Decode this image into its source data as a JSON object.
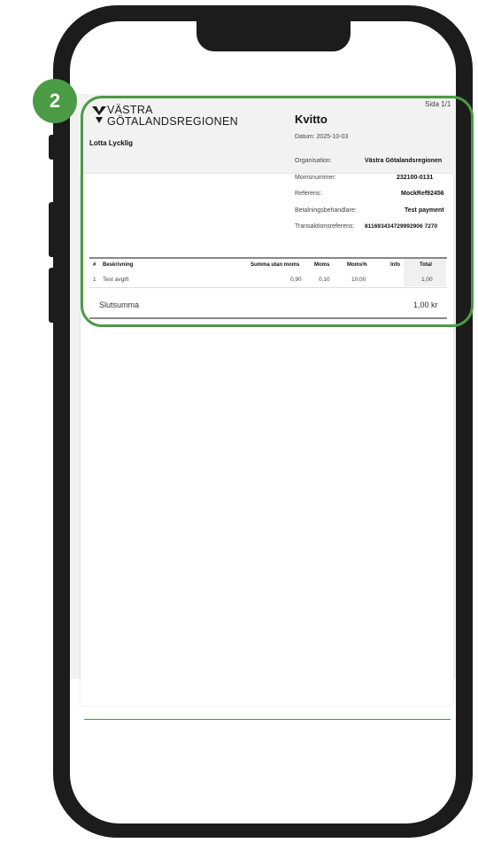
{
  "step_badge": "2",
  "page": {
    "label": "Sida 1/1"
  },
  "org_logo": {
    "line1": "VÄSTRA",
    "line2": "GÖTALANDSREGIONEN"
  },
  "receipt": {
    "title": "Kvitto",
    "date_line": "Datum: 2025-10-03",
    "customer_name": "Lotta Lycklig",
    "details": [
      {
        "label": "Organisation:",
        "value": "Västra Götalandsregionen"
      },
      {
        "label": "Momsnummer:",
        "value": "232100-0131"
      },
      {
        "label": "Referens:",
        "value": "MockRef92456"
      },
      {
        "label": "Betalningsbehandlare:",
        "value": "Test payment"
      },
      {
        "label": "Transaktionsreferens:",
        "value": "811693434729992906 7270"
      }
    ],
    "table": {
      "headers": [
        "#",
        "Beskrivning",
        "Summa utan moms",
        "Moms",
        "Moms%",
        "Info",
        "Total"
      ],
      "rows": [
        [
          "1",
          "Test avgift",
          "0,90",
          "0,10",
          "10,00",
          "",
          "1,00"
        ]
      ]
    },
    "total_label": "Slutsumma",
    "total_value": "1,00 kr"
  },
  "colors": {
    "accent_green": "#4b9b45",
    "phone_frame": "#1c1c1c"
  }
}
